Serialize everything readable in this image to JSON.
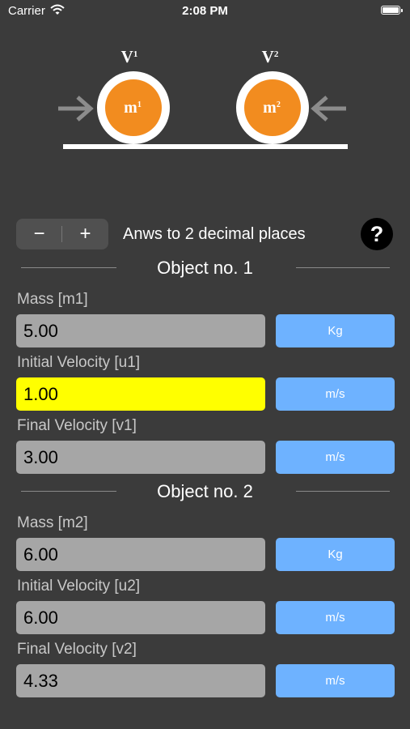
{
  "status_bar": {
    "carrier": "Carrier",
    "time": "2:08 PM"
  },
  "diagram": {
    "v1_base": "V",
    "v1_sub": "1",
    "v2_base": "V",
    "v2_sub": "2",
    "m1_base": "m",
    "m1_sub": "1",
    "m2_base": "m",
    "m2_sub": "2",
    "ball_color": "#f28c1f"
  },
  "controls": {
    "minus_label": "−",
    "plus_label": "+",
    "precision_text": "Anws to 2 decimal places",
    "help_label": "?"
  },
  "object1": {
    "title": "Object no. 1",
    "mass_label": "Mass [m1]",
    "mass_value": "5.00",
    "mass_unit": "Kg",
    "initial_label": "Initial Velocity [u1]",
    "initial_value": "1.00",
    "initial_unit": "m/s",
    "final_label": "Final Velocity [v1]",
    "final_value": "3.00",
    "final_unit": "m/s"
  },
  "object2": {
    "title": "Object no. 2",
    "mass_label": "Mass [m2]",
    "mass_value": "6.00",
    "mass_unit": "Kg",
    "initial_label": "Initial Velocity [u2]",
    "initial_value": "6.00",
    "initial_unit": "m/s",
    "final_label": "Final Velocity [v2]",
    "final_value": "4.33",
    "final_unit": "m/s"
  },
  "colors": {
    "background": "#3b3b3b",
    "field": "#a6a6a6",
    "active_field": "#ffff00",
    "unit_button": "#6eb2ff"
  }
}
